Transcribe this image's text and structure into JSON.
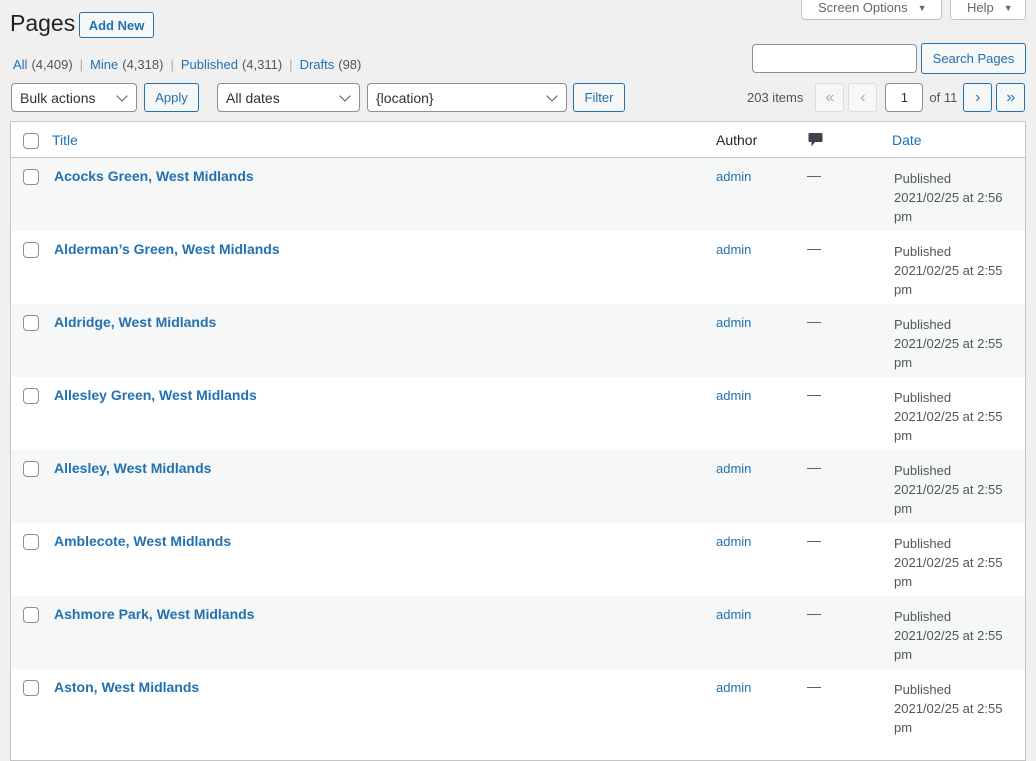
{
  "screen_meta": {
    "screen_options": "Screen Options",
    "help": "Help"
  },
  "header": {
    "title": "Pages",
    "add_new": "Add New"
  },
  "views": [
    {
      "label": "All",
      "count": "(4,409)"
    },
    {
      "label": "Mine",
      "count": "(4,318)"
    },
    {
      "label": "Published",
      "count": "(4,311)"
    },
    {
      "label": "Drafts",
      "count": "(98)"
    }
  ],
  "search": {
    "value": "",
    "button": "Search Pages"
  },
  "tablenav": {
    "bulk_actions": "Bulk actions",
    "apply": "Apply",
    "dates": "All dates",
    "location": "{location}",
    "filter": "Filter",
    "items_count": "203 items",
    "first": "«",
    "prev": "‹",
    "current_page": "1",
    "total_pages": "of 11",
    "next": "›",
    "last": "»"
  },
  "table": {
    "columns": {
      "title": "Title",
      "author": "Author",
      "comments_icon": "comment-icon",
      "date": "Date"
    },
    "rows": [
      {
        "title": "Acocks Green, West Midlands",
        "author": "admin",
        "comments": "—",
        "status": "Published",
        "date": "2021/02/25 at 2:56 pm"
      },
      {
        "title": "Alderman’s Green, West Midlands",
        "author": "admin",
        "comments": "—",
        "status": "Published",
        "date": "2021/02/25 at 2:55 pm"
      },
      {
        "title": "Aldridge, West Midlands",
        "author": "admin",
        "comments": "—",
        "status": "Published",
        "date": "2021/02/25 at 2:55 pm"
      },
      {
        "title": "Allesley Green, West Midlands",
        "author": "admin",
        "comments": "—",
        "status": "Published",
        "date": "2021/02/25 at 2:55 pm"
      },
      {
        "title": "Allesley, West Midlands",
        "author": "admin",
        "comments": "—",
        "status": "Published",
        "date": "2021/02/25 at 2:55 pm"
      },
      {
        "title": "Amblecote, West Midlands",
        "author": "admin",
        "comments": "—",
        "status": "Published",
        "date": "2021/02/25 at 2:55 pm"
      },
      {
        "title": "Ashmore Park, West Midlands",
        "author": "admin",
        "comments": "—",
        "status": "Published",
        "date": "2021/02/25 at 2:55 pm"
      },
      {
        "title": "Aston, West Midlands",
        "author": "admin",
        "comments": "—",
        "status": "Published",
        "date": "2021/02/25 at 2:55 pm"
      }
    ]
  },
  "colors": {
    "link": "#2271b1",
    "background": "#f0f0f1",
    "row_alt": "#f6f7f7"
  }
}
